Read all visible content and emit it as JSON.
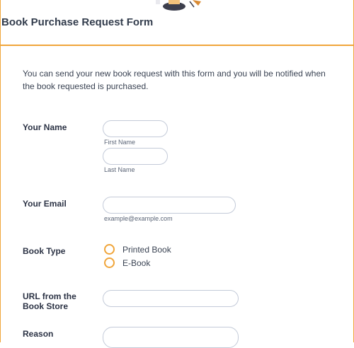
{
  "form": {
    "title": "Book Purchase Request Form",
    "intro": "You can send your new book request with this form and you will be notified when the book requested is purchased."
  },
  "fields": {
    "name": {
      "label": "Your Name",
      "first_sub": "First Name",
      "last_sub": "Last Name"
    },
    "email": {
      "label": "Your Email",
      "sub": "example@example.com"
    },
    "book_type": {
      "label": "Book Type",
      "options": [
        "Printed Book",
        "E-Book"
      ]
    },
    "url": {
      "label": "URL from the Book Store"
    },
    "reason": {
      "label": "Reason"
    }
  },
  "colors": {
    "accent": "#f0a53a",
    "input_border": "#c3cad8",
    "text": "#2c3345"
  }
}
